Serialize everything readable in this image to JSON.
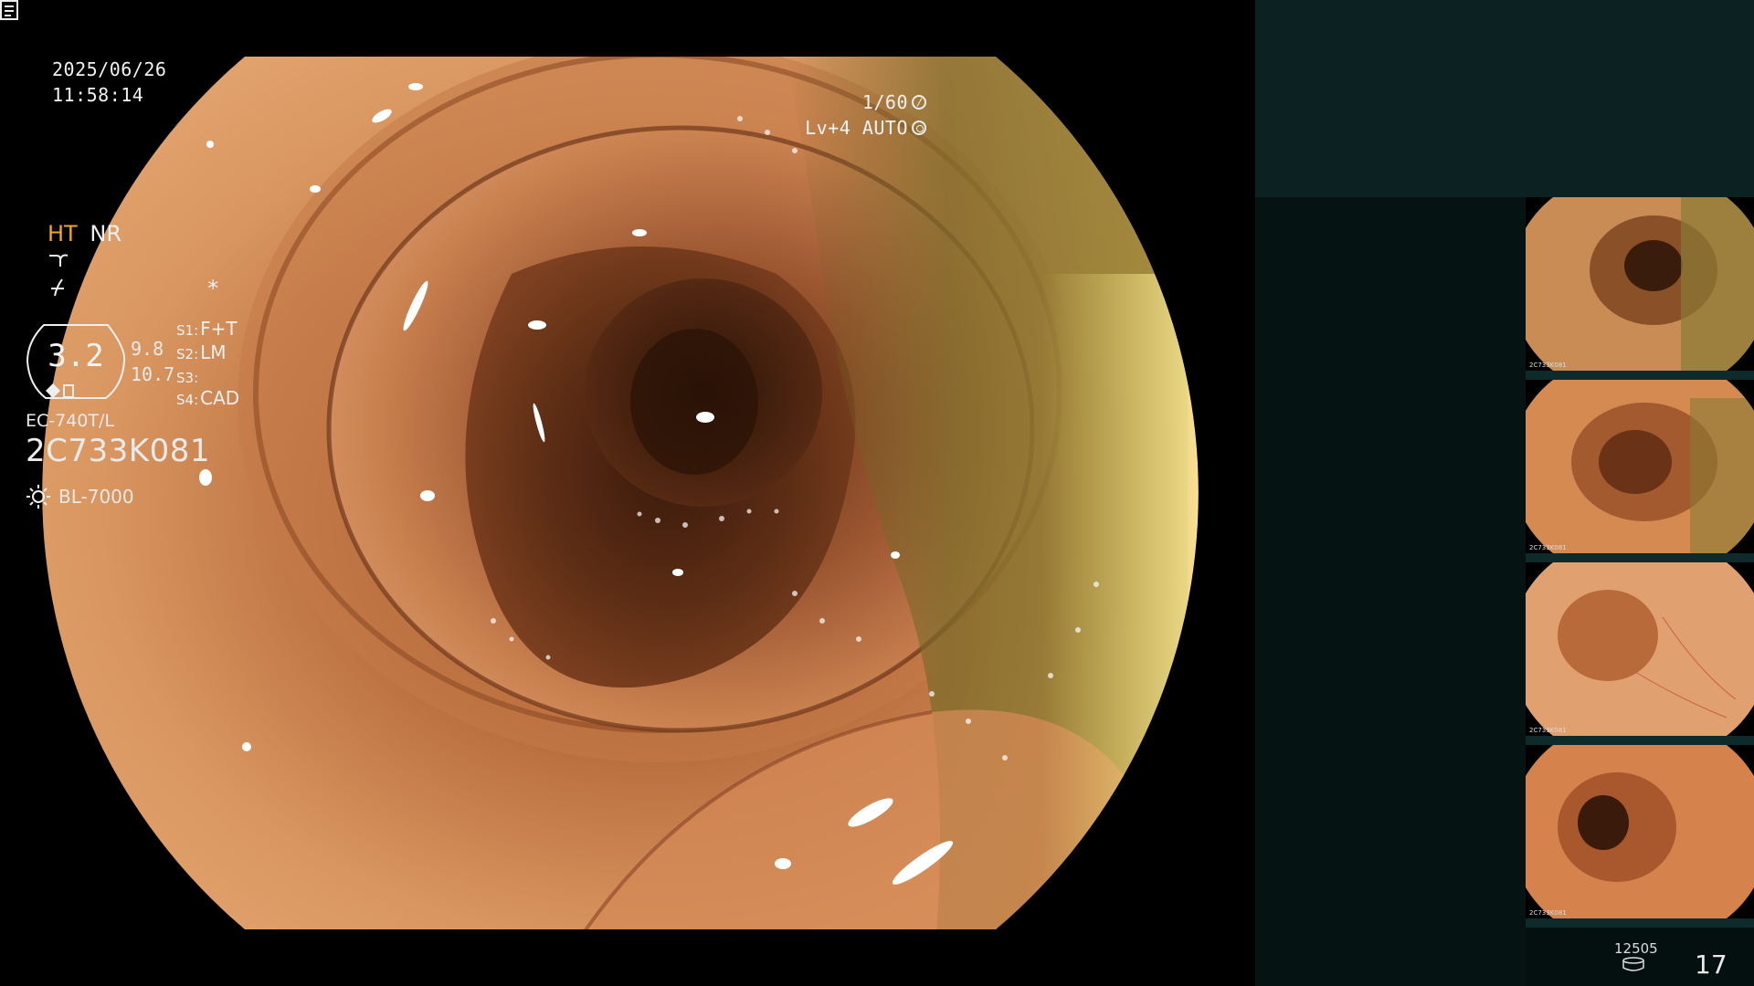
{
  "overlay": {
    "date": "2025/06/26",
    "time": "11:58:14",
    "shutter": "1/60",
    "level_mode": "Lv+4  AUTO"
  },
  "panel": {
    "mode_ht": "HT",
    "mode_nr": "NR",
    "zoom": "3.2",
    "zoom_aux1": "9.8",
    "zoom_aux2": "10.7",
    "switches": [
      {
        "key": "S1:",
        "value": "F+T"
      },
      {
        "key": "S2:",
        "value": "LM"
      },
      {
        "key": "S3:",
        "value": ""
      },
      {
        "key": "S4:",
        "value": "CAD"
      }
    ],
    "scope_model": "EC-740T/L",
    "scope_serial": "2C733K081",
    "light_source": "BL-7000",
    "asterisk": "*"
  },
  "thumbnails": {
    "serial_label": "2C733K081"
  },
  "footer": {
    "counter": "12505",
    "number": "17"
  },
  "colors": {
    "mode_ht_accent": "#f2a526",
    "panel_top": "#0c2222",
    "panel_info": "#051413"
  },
  "icons": [
    "tone-curve-icon",
    "enhancement-icon",
    "memo-icon",
    "sun-icon",
    "disk-icon",
    "shutter-icon",
    "aperture-icon"
  ]
}
